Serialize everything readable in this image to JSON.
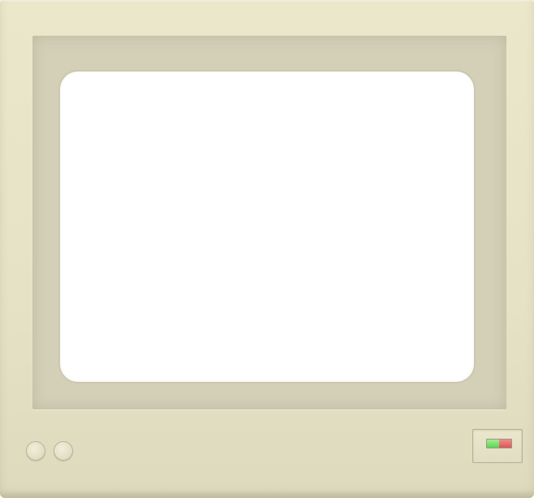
{
  "monitor": {
    "body_color": "#e7e3c7",
    "bezel_color": "#d4d0b8",
    "screen_color": "#ffffff",
    "knobs": [
      "knob",
      "knob"
    ],
    "power_indicator": {
      "on_color": "#5fd25a",
      "off_color": "#d95757"
    }
  }
}
